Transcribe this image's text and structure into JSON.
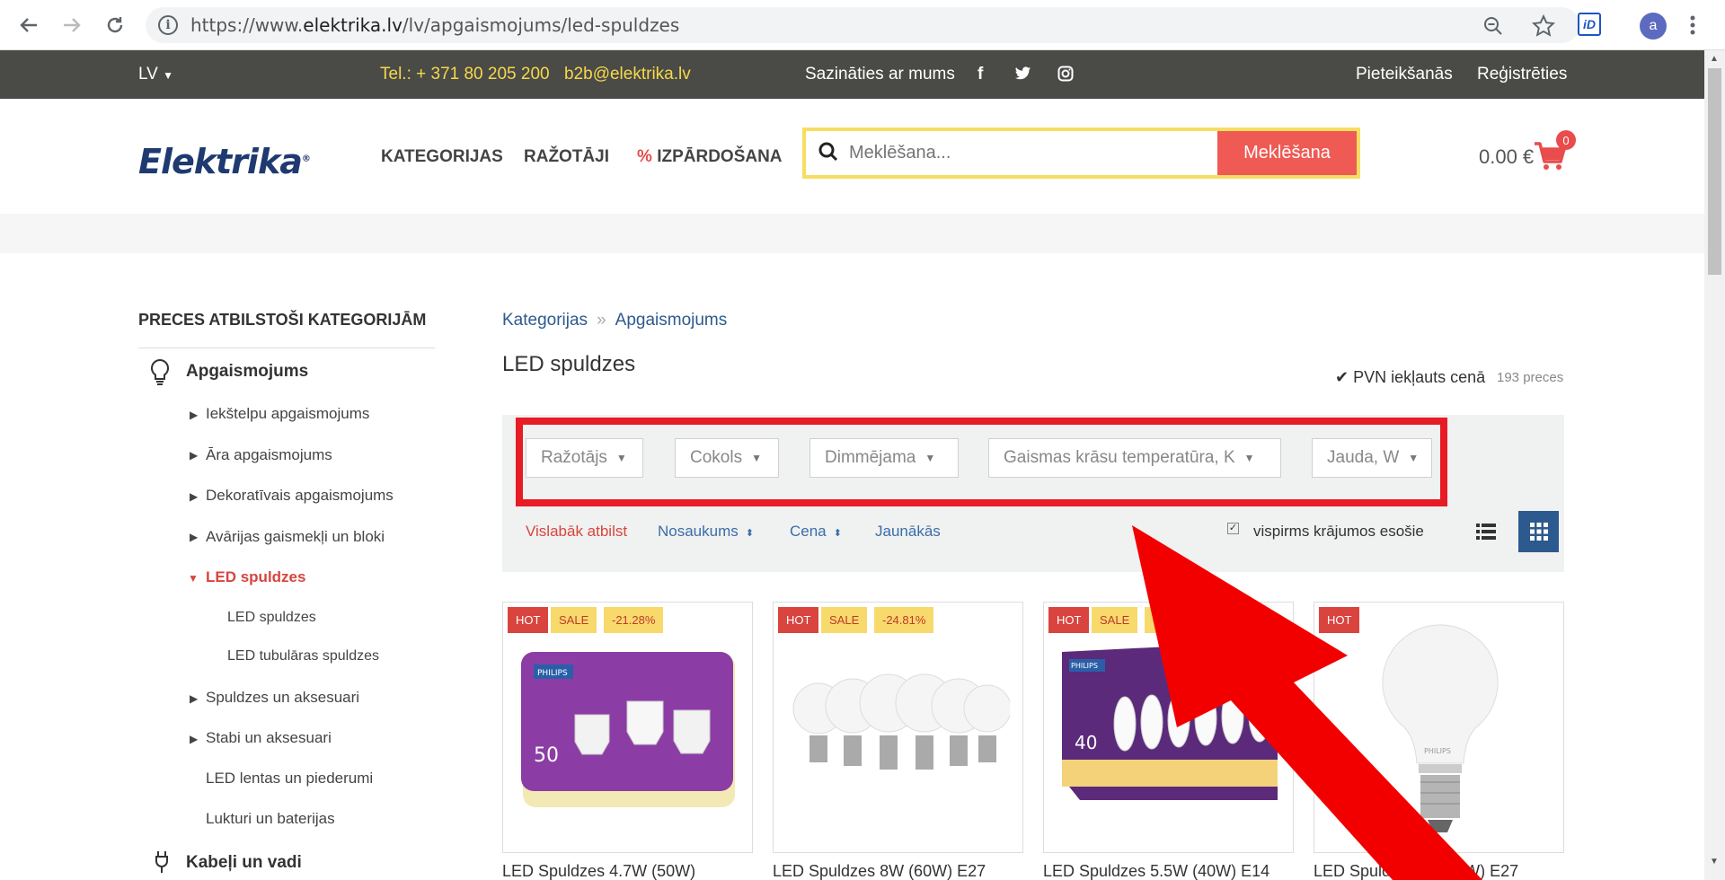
{
  "browser": {
    "url_prefix": "https://www.",
    "url_domain": "elektrika.lv",
    "url_path": "/lv/apgaismojums/led-spuldzes",
    "profile_initial": "a",
    "ext_label": "iD"
  },
  "topbar": {
    "language": "LV",
    "phone": "Tel.: + 371 80 205 200",
    "email": "b2b@elektrika.lv",
    "contact": "Sazināties ar mums",
    "login": "Pieteikšanās",
    "register": "Reģistrēties"
  },
  "header": {
    "logo": "Elektrika",
    "logo_mark": "®",
    "menu_categories": "KATEGORIJAS",
    "menu_brands": "RAŽOTĀJI",
    "menu_sale_pct": "%",
    "menu_sale": "IZPĀRDOŠANA",
    "search_placeholder": "Meklēšana...",
    "search_button": "Meklēšana",
    "cart_total": "0.00 €",
    "cart_count": "0"
  },
  "sidebar": {
    "title": "PRECES ATBILSTOŠI KATEGORIJĀM",
    "category": "Apgaismojums",
    "items": [
      "Iekštelpu apgaismojums",
      "Āra apgaismojums",
      "Dekoratīvais apgaismojums",
      "Avārijas gaismekļi un bloki",
      "LED spuldzes",
      "LED spuldzes",
      "LED tubulāras spuldzes",
      "Spuldzes un aksesuari",
      "Stabi un aksesuari",
      "LED lentas un piederumi",
      "Lukturi un baterijas"
    ],
    "next_category": "Kabeļi un vadi"
  },
  "main": {
    "breadcrumb": [
      "Kategorijas",
      "Apgaismojums"
    ],
    "breadcrumb_sep": "»",
    "title": "LED spuldzes",
    "vat": "PVN iekļauts cenā",
    "count": "193 preces",
    "filters": [
      "Ražotājs",
      "Cokols",
      "Dimmējama",
      "Gaismas krāsu temperatūra, K",
      "Jauda, W"
    ],
    "sort": [
      "Vislabāk atbilst",
      "Nosaukums",
      "Cena",
      "Jaunākās"
    ],
    "stock_label": "vispirms krājumos esošie"
  },
  "products": [
    {
      "hot": "HOT",
      "sale": "SALE",
      "discount": "-21.28%",
      "title": "LED Spuldzes 4.7W (50W)"
    },
    {
      "hot": "HOT",
      "sale": "SALE",
      "discount": "-24.81%",
      "title": "LED Spuldzes 8W (60W) E27"
    },
    {
      "hot": "HOT",
      "sale": "SALE",
      "discount": "-24.",
      "title": "LED Spuldzes 5.5W (40W) E14"
    },
    {
      "hot": "HOT",
      "sale": "",
      "discount": "",
      "title": "LED Spuldze 7W (60W) E27"
    }
  ],
  "colors": {
    "accent_red": "#ef5a54",
    "brand_blue": "#1f3a70",
    "link_blue": "#2d5a8e",
    "yellow": "#f6d94a",
    "dark_bar": "#4a4a47",
    "highlight_red": "#e81c25"
  }
}
